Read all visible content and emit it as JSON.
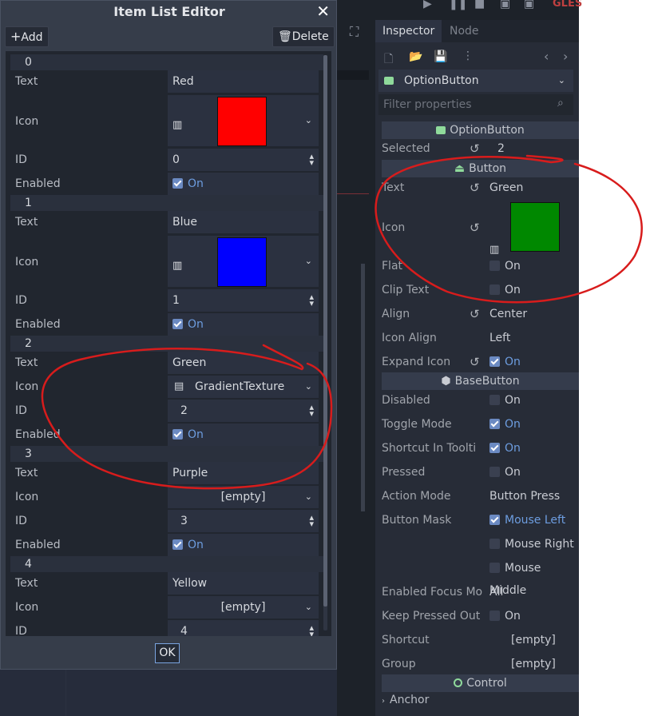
{
  "dialog": {
    "title": "Item List Editor",
    "add_label": "Add",
    "delete_label": "Delete",
    "ok_label": "OK",
    "items": [
      {
        "index": "0",
        "text": "Red",
        "icon": "red-swatch",
        "icon_color": "#ff0000",
        "id": "0",
        "enabled": "On"
      },
      {
        "index": "1",
        "text": "Blue",
        "icon": "blue-swatch",
        "icon_color": "#0000ff",
        "id": "1",
        "enabled": "On"
      },
      {
        "index": "2",
        "text": "Green",
        "icon_label": "GradientTexture",
        "id": "2",
        "enabled": "On"
      },
      {
        "index": "3",
        "text": "Purple",
        "icon_label": "[empty]",
        "id": "3",
        "enabled": "On"
      },
      {
        "index": "4",
        "text": "Yellow",
        "icon_label": "[empty]",
        "id": "4"
      }
    ],
    "labels": {
      "text": "Text",
      "icon": "Icon",
      "id": "ID",
      "enabled": "Enabled"
    }
  },
  "toolbar": {
    "gles_label": "GLES"
  },
  "inspector": {
    "tabs": [
      "Inspector",
      "Node"
    ],
    "node_type": "OptionButton",
    "filter_placeholder": "Filter properties",
    "sections": {
      "option_button": "OptionButton",
      "button": "Button",
      "base_button": "BaseButton",
      "control": "Control"
    },
    "props": {
      "selected": {
        "label": "Selected",
        "value": "2"
      },
      "text": {
        "label": "Text",
        "value": "Green"
      },
      "icon": {
        "label": "Icon",
        "color": "#008800"
      },
      "flat": {
        "label": "Flat",
        "value": "On"
      },
      "clip_text": {
        "label": "Clip Text",
        "value": "On"
      },
      "align": {
        "label": "Align",
        "value": "Center"
      },
      "icon_align": {
        "label": "Icon Align",
        "value": "Left"
      },
      "expand_icon": {
        "label": "Expand Icon",
        "value": "On"
      },
      "disabled": {
        "label": "Disabled",
        "value": "On"
      },
      "toggle_mode": {
        "label": "Toggle Mode",
        "value": "On"
      },
      "shortcut_in_tooltip": {
        "label": "Shortcut In Toolti",
        "value": "On"
      },
      "pressed": {
        "label": "Pressed",
        "value": "On"
      },
      "action_mode": {
        "label": "Action Mode",
        "value": "Button Press"
      },
      "button_mask": {
        "label": "Button Mask",
        "left": "Mouse Left",
        "right": "Mouse Right",
        "middle": "Mouse Middle"
      },
      "enabled_focus_mode": {
        "label": "Enabled Focus Mo",
        "value": "All"
      },
      "keep_pressed_outside": {
        "label": "Keep Pressed Out",
        "value": "On"
      },
      "shortcut": {
        "label": "Shortcut",
        "value": "[empty]"
      },
      "group": {
        "label": "Group",
        "value": "[empty]"
      },
      "anchor": {
        "label": "Anchor"
      }
    }
  },
  "colors": {
    "accent": "#6d9de0",
    "annotation": "#d81c1c"
  }
}
